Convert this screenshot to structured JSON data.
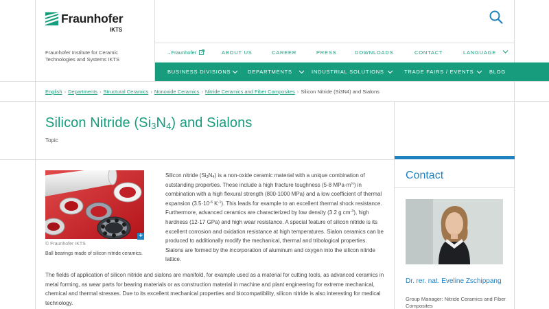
{
  "header": {
    "logo_word": "Fraunhofer",
    "logo_sub": "IKTS",
    "institute_line1": "Fraunhofer Institute for Ceramic",
    "institute_line2": "Technologies and Systems IKTS"
  },
  "topnav": {
    "home": "Fraunhofer",
    "items": [
      "ABOUT US",
      "CAREER",
      "PRESS",
      "DOWNLOADS",
      "CONTACT",
      "LANGUAGE"
    ]
  },
  "mainnav": {
    "items": [
      "BUSINESS DIVISIONS",
      "DEPARTMENTS",
      "INDUSTRIAL SOLUTIONS",
      "TRADE FAIRS / EVENTS",
      "BLOG"
    ]
  },
  "breadcrumb": {
    "links": [
      "English",
      "Departments",
      "Structural Ceramics",
      "Nonoxide Ceramics",
      "Nitride Ceramics and Fiber Composites"
    ],
    "current": "Silicon Nitride (Si3N4) and Sialons",
    "separator": "›"
  },
  "page": {
    "title_pre": "Silicon Nitride (Si",
    "title_sub1": "3",
    "title_mid": "N",
    "title_sub2": "4",
    "title_post": ") and Sialons",
    "topic": "Topic"
  },
  "figure": {
    "copyright": "© Fraunhofer IKTS",
    "caption": "Ball bearings made of silicon nitride ceramics.",
    "zoom_label": "+"
  },
  "paragraph1": {
    "a": "Silicon nitride (Si",
    "a_sub1": "3",
    "a2": "N",
    "a_sub2": "4",
    "b": ") is a non-oxide ceramic material with a unique combination of outstanding properties. These include a high fracture toughness (5-8 MPa·m",
    "b_sup": "½",
    "c": ") in combination with a high flexural strength (800-1000 MPa) and a low coefficient of thermal expansion (3.5·10",
    "c_sup": "-6",
    "d": " K",
    "d_sup": "-1",
    "e": "). This leads for example to an excellent thermal shock resistance. Furthermore, advanced ceramics are characterized by low density (3.2 g cm",
    "e_sup": "-3",
    "f": "), high hardness (12-17 GPa) and high wear resistance. A special feature of silicon nitride is its excellent corrosion and oxidation resistance at high temperatures. Sialon ceramics can be produced to additionally modify the mechanical, thermal and tribological properties. Sialons are formed by the incorporation of aluminum and oxygen into the silicon nitride lattice."
  },
  "paragraph2": {
    "text": "The fields of application of silicon nitride and sialons are manifold, for example used as a material for cutting tools, as advanced ceramics in metal forming, as wear parts for bearing materials or as construction material in machine and plant engineering for extreme mechanical, chemical and thermal stresses. Due to its excellent mechanical properties and biocompatibility, silicon nitride is also interesting for medical technology."
  },
  "contact": {
    "title": "Contact",
    "name": "Dr. rer. nat. Eveline Zschippang",
    "role": "Group Manager: Nitride Ceramics and Fiber Composites"
  },
  "colors": {
    "brand_green": "#179c7d",
    "link_blue": "#1f82c0"
  }
}
